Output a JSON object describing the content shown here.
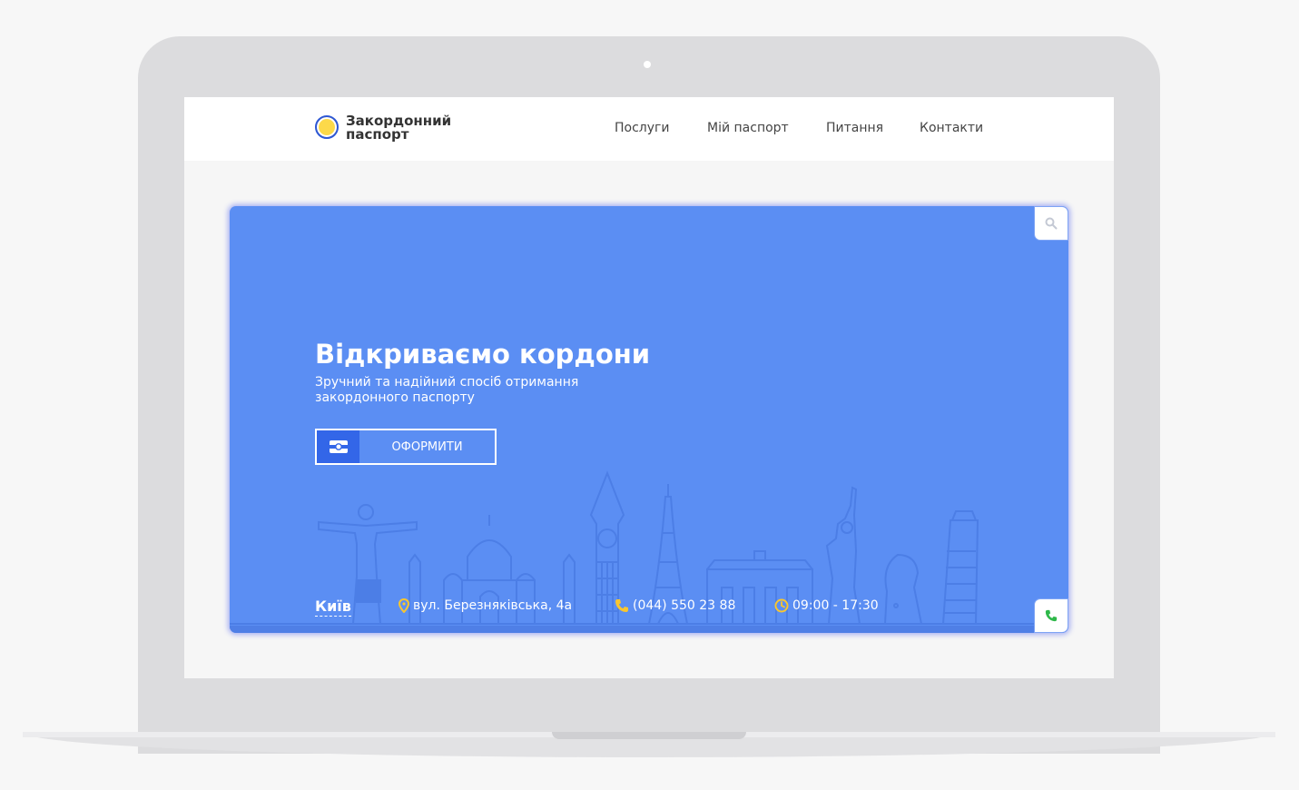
{
  "logo": {
    "line1": "Закордонний",
    "line2": "паспорт"
  },
  "nav": {
    "items": [
      {
        "label": "Послуги"
      },
      {
        "label": "Мій паспорт"
      },
      {
        "label": "Питання"
      },
      {
        "label": "Контакти"
      }
    ]
  },
  "hero": {
    "title": "Відкриваємо кордони",
    "subtitle": "Зручний та надійний спосіб отримання закордонного паспорту",
    "cta_label": "ОФОРМИТИ",
    "city": "Київ",
    "address": "вул. Березняківська, 4а",
    "phone": "(044) 550 23 88",
    "hours": "09:00 - 17:30"
  },
  "icons": {
    "search": "search-icon",
    "phone_button": "phone-icon",
    "cta": "passport-icon",
    "address": "map-pin-icon",
    "phone": "phone-icon",
    "hours": "clock-icon"
  },
  "colors": {
    "hero_bg": "#5b8ef3",
    "accent_blue": "#3366e8",
    "logo_yellow": "#fcd94a",
    "icon_yellow": "#f8c630",
    "phone_green": "#2fb84a"
  }
}
